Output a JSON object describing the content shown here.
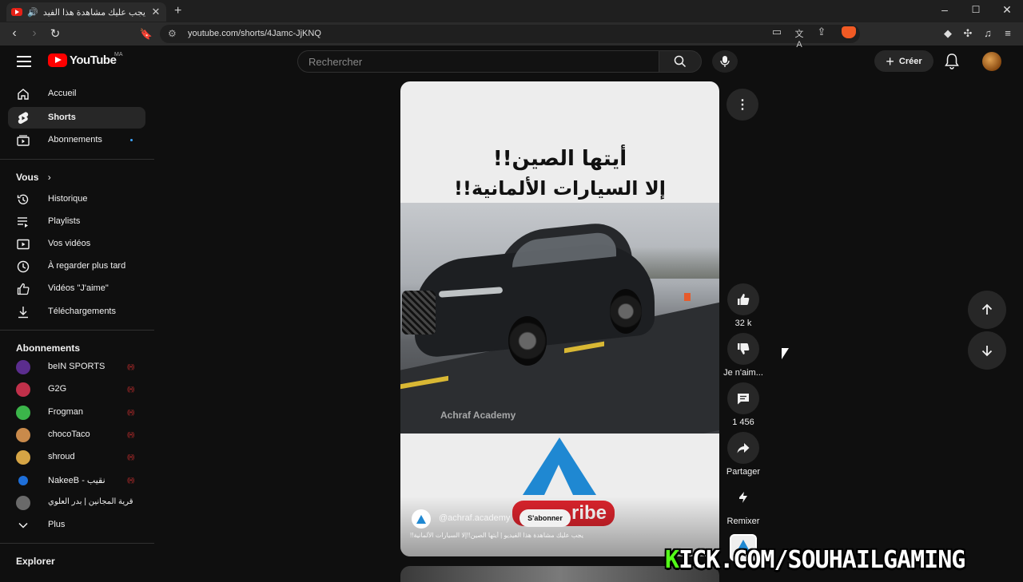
{
  "browser": {
    "tab_title": "يجب عليك مشاهدة هذا الفيديو",
    "url": "youtube.com/shorts/4Jamc-JjKNQ"
  },
  "header": {
    "logo_text": "YouTube",
    "country_code": "MA",
    "search_placeholder": "Rechercher",
    "create_label": "Créer"
  },
  "sidebar": {
    "main": [
      {
        "label": "Accueil",
        "icon": "home-icon"
      },
      {
        "label": "Shorts",
        "icon": "shorts-icon",
        "active": true
      },
      {
        "label": "Abonnements",
        "icon": "subscriptions-icon"
      }
    ],
    "you_heading": "Vous",
    "you": [
      {
        "label": "Historique",
        "icon": "history-icon"
      },
      {
        "label": "Playlists",
        "icon": "playlists-icon"
      },
      {
        "label": "Vos vidéos",
        "icon": "your-videos-icon"
      },
      {
        "label": "À regarder plus tard",
        "icon": "watch-later-icon"
      },
      {
        "label": "Vidéos \"J'aime\"",
        "icon": "liked-videos-icon"
      },
      {
        "label": "Téléchargements",
        "icon": "downloads-icon"
      }
    ],
    "subs_heading": "Abonnements",
    "subscriptions": [
      {
        "label": "beIN SPORTS",
        "color": "#5b2d8e",
        "live": true
      },
      {
        "label": "G2G",
        "color": "#c0304a",
        "live": true
      },
      {
        "label": "Frogman",
        "color": "#3bb54a",
        "live": true
      },
      {
        "label": "chocoTaco",
        "color": "#c98a4b",
        "live": true
      },
      {
        "label": "shroud",
        "color": "#d6a545",
        "live": true
      },
      {
        "label": "NakeeB - نقيب",
        "color": "#1e6fd9",
        "live": true
      },
      {
        "label": "قرية المجانين | بدر العلوي",
        "color": "#6a6a6a",
        "live": false
      }
    ],
    "more_label": "Plus",
    "explore_heading": "Explorer"
  },
  "short": {
    "headline_line1": "أيتها الصين!!",
    "headline_line2": "إلا السيارات الألمانية!!",
    "watermark": "Achraf Academy",
    "subscribe_graphic": "ribe",
    "channel_handle": "@achraf.academy",
    "subscribe_button": "S'abonner",
    "caption": "يجب عليك مشاهدة هذا الفيديو | أيتها الصين!!إلا السيارات الألمانية!!"
  },
  "actions": {
    "likes": "32 k",
    "dislike_label": "Je n'aim...",
    "comments": "1 456",
    "share_label": "Partager",
    "remix_label": "Remixer"
  },
  "overlay": {
    "kick_k": "K",
    "kick_rest": "ICK.COM/SOUHAILGAMING"
  },
  "colors": {
    "youtube_red": "#ff0000",
    "live_red": "#b02a2a",
    "kick_green": "#53fc18"
  }
}
